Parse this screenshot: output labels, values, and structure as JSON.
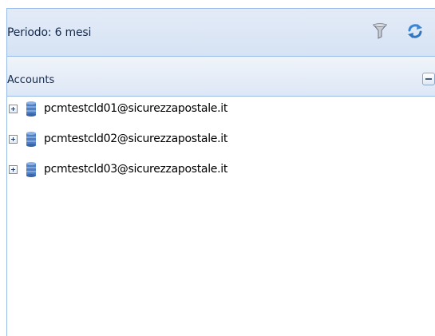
{
  "header": {
    "title": "Periodo: 6 mesi",
    "filter_icon": "filter-icon",
    "refresh_icon": "refresh-icon"
  },
  "accounts_panel": {
    "title": "Accounts",
    "collapse_icon": "collapse-minus-icon",
    "items": [
      {
        "label": "pcmtestcld01@sicurezzapostale.it",
        "icon": "database-icon"
      },
      {
        "label": "pcmtestcld02@sicurezzapostale.it",
        "icon": "database-icon"
      },
      {
        "label": "pcmtestcld03@sicurezzapostale.it",
        "icon": "database-icon"
      }
    ]
  },
  "colors": {
    "border": "#99bbe8",
    "header_bg": "#d6e3f4",
    "text": "#15294b"
  }
}
